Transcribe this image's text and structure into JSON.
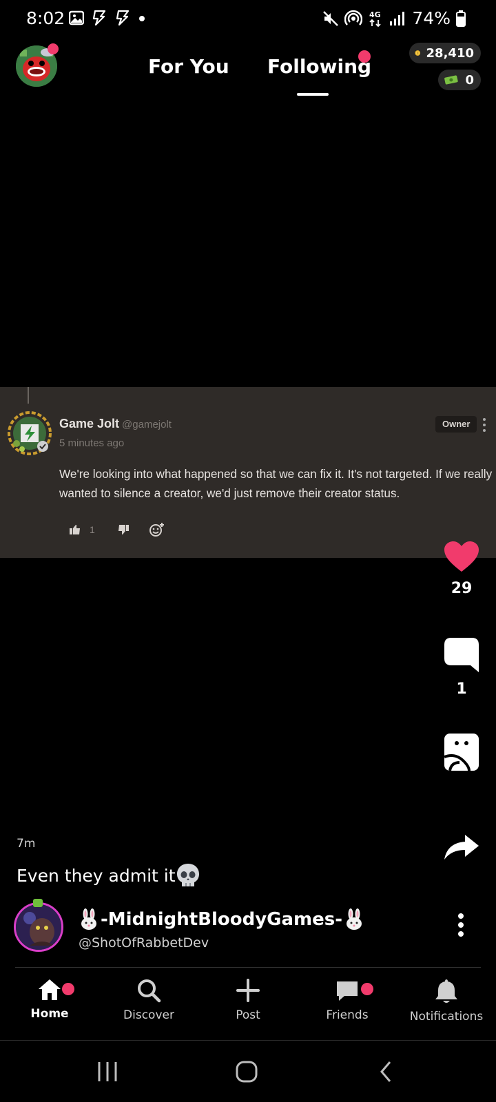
{
  "status_bar": {
    "time": "8:02",
    "battery": "74%",
    "icons": [
      "gallery-icon",
      "bolt-icon",
      "bolt-icon",
      "dot-icon",
      "mute-icon",
      "hotspot-icon",
      "4g-icon",
      "signal-icon",
      "battery-icon"
    ]
  },
  "header": {
    "tabs": [
      {
        "label": "For You",
        "active": false
      },
      {
        "label": "Following",
        "active": true
      }
    ],
    "coins": "28,410",
    "cash": "0"
  },
  "comment": {
    "author": "Game Jolt",
    "handle": "@gamejolt",
    "time": "5 minutes ago",
    "badge": "Owner",
    "body": "We're looking into what happened so that we can fix it. It's not targeted. If we really wanted to silence a creator, we'd just remove their creator status.",
    "likes": "1"
  },
  "rail": {
    "like_count": "29",
    "comment_count": "1"
  },
  "post": {
    "time": "7m",
    "caption": "Even they admit it",
    "author_name": "-MidnightBloodyGames-",
    "author_handle": "@ShotOfRabbetDev"
  },
  "nav": {
    "items": [
      {
        "label": "Home",
        "active": true
      },
      {
        "label": "Discover",
        "active": false
      },
      {
        "label": "Post",
        "active": false
      },
      {
        "label": "Friends",
        "active": false
      },
      {
        "label": "Notifications",
        "active": false
      }
    ]
  },
  "colors": {
    "accent": "#f13b6c",
    "background": "#000000",
    "comment_card": "#2f2b28"
  }
}
